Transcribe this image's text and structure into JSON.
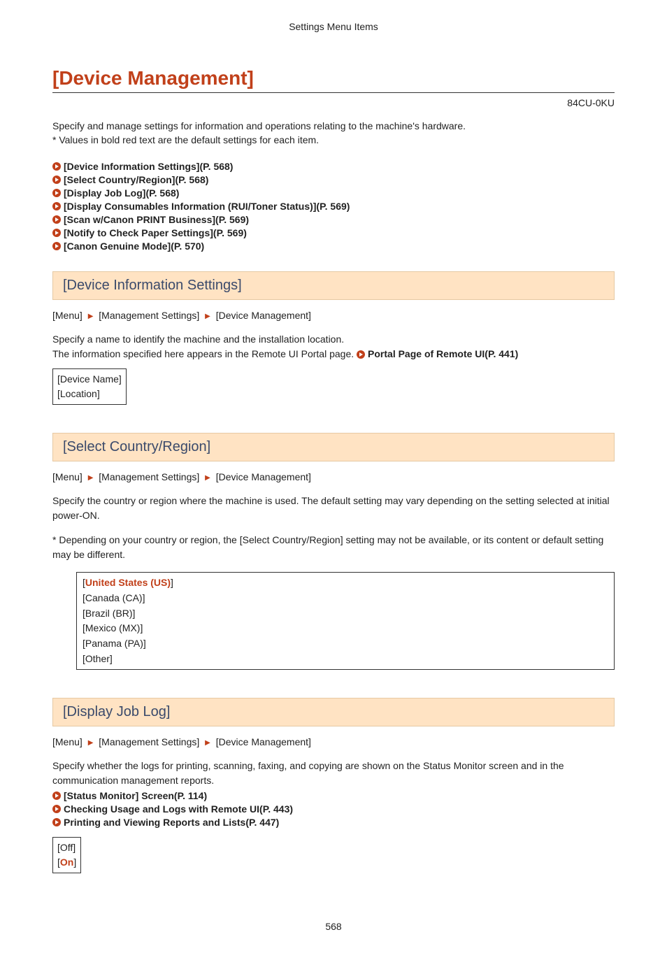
{
  "header": {
    "breadcrumb_title": "Settings Menu Items"
  },
  "page": {
    "title": "[Device Management]",
    "doc_id": "84CU-0KU",
    "number": "568"
  },
  "intro": {
    "line1": "Specify and manage settings for information and operations relating to the machine's hardware.",
    "line2": "* Values in bold red text are the default settings for each item."
  },
  "toc": [
    {
      "label": "[Device Information Settings](P. 568)"
    },
    {
      "label": "[Select Country/Region](P. 568)"
    },
    {
      "label": "[Display Job Log](P. 568)"
    },
    {
      "label": "[Display Consumables Information (RUI/Toner Status)](P. 569)"
    },
    {
      "label": "[Scan w/Canon PRINT Business](P. 569)"
    },
    {
      "label": "[Notify to Check Paper Settings](P. 569)"
    },
    {
      "label": "[Canon Genuine Mode](P. 570)"
    }
  ],
  "breadcrumb": {
    "seg1": "[Menu]",
    "seg2": "[Management Settings]",
    "seg3": "[Device Management]"
  },
  "sections": {
    "s1": {
      "heading": "[Device Information Settings]",
      "p1": "Specify a name to identify the machine and the installation location.",
      "p2_prefix": "The information specified here appears in the Remote UI Portal page. ",
      "p2_link": "Portal Page of Remote UI(P. 441)",
      "values": [
        "[Device Name]",
        "[Location]"
      ]
    },
    "s2": {
      "heading": "[Select Country/Region]",
      "p1": "Specify the country or region where the machine is used. The default setting may vary depending on the setting selected at initial power-ON.",
      "p2": "* Depending on your country or region, the [Select Country/Region] setting may not be available, or its content or default setting may be different.",
      "values": [
        {
          "text": "United States (US)",
          "default": true
        },
        {
          "text": "[Canada (CA)]",
          "default": false
        },
        {
          "text": "[Brazil (BR)]",
          "default": false
        },
        {
          "text": "[Mexico (MX)]",
          "default": false
        },
        {
          "text": "[Panama (PA)]",
          "default": false
        },
        {
          "text": "[Other]",
          "default": false
        }
      ]
    },
    "s3": {
      "heading": "[Display Job Log]",
      "p1": "Specify whether the logs for printing, scanning, faxing, and copying are shown on the Status Monitor screen and in the communication management reports.",
      "links": [
        "[Status Monitor] Screen(P. 114)",
        "Checking Usage and Logs with Remote UI(P. 443)",
        "Printing and Viewing Reports and Lists(P. 447)"
      ],
      "values": [
        {
          "text": "[Off]",
          "default": false
        },
        {
          "text": "On",
          "default": true
        }
      ]
    }
  }
}
